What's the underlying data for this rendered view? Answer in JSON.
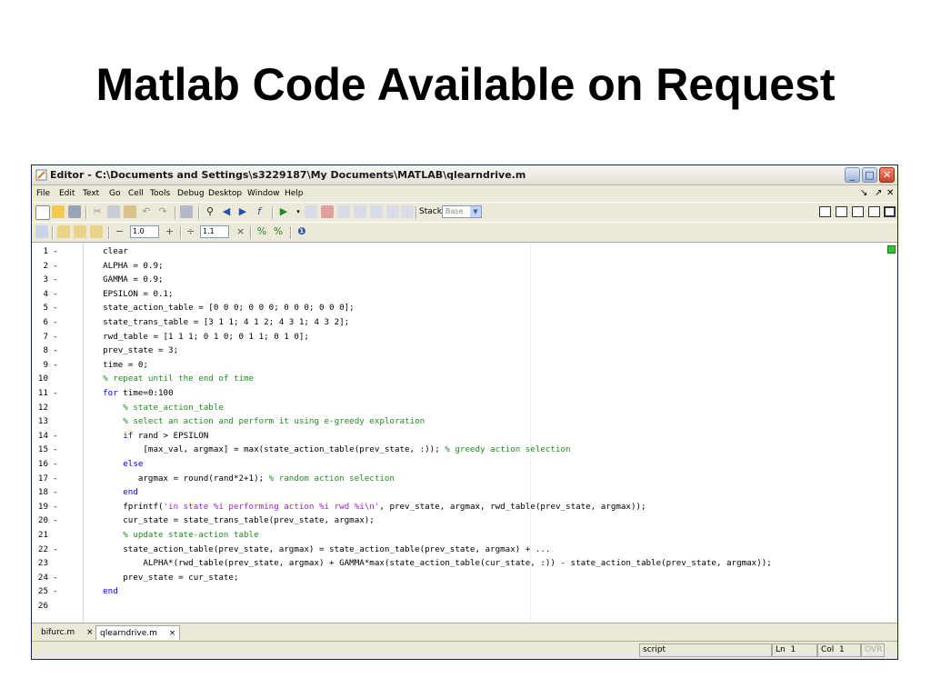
{
  "slide": {
    "title": "Matlab Code Available on Request"
  },
  "window": {
    "title": "Editor - C:\\Documents and Settings\\s3229187\\My Documents\\MATLAB\\qlearndrive.m",
    "min": "_",
    "max": "□",
    "close": "✕"
  },
  "menu": {
    "items": [
      "File",
      "Edit",
      "Text",
      "Go",
      "Cell",
      "Tools",
      "Debug",
      "Desktop",
      "Window",
      "Help"
    ],
    "dock_icons": [
      "↘",
      "↗",
      "✕"
    ]
  },
  "toolbar": {
    "stack_label": "Stack:",
    "stack_value": "Base"
  },
  "cellbar": {
    "minus": "−",
    "value1": "1.0",
    "plus": "+",
    "divide": "÷",
    "value2": "1.1",
    "times": "×"
  },
  "code": [
    {
      "n": "1",
      "d": "-",
      "segs": [
        {
          "t": "    clear",
          "c": ""
        }
      ]
    },
    {
      "n": "2",
      "d": "-",
      "segs": [
        {
          "t": "    ALPHA = 0.9;",
          "c": ""
        }
      ]
    },
    {
      "n": "3",
      "d": "-",
      "segs": [
        {
          "t": "    GAMMA = 0.9;",
          "c": ""
        }
      ]
    },
    {
      "n": "4",
      "d": "-",
      "segs": [
        {
          "t": "    EPSILON = 0.1;",
          "c": ""
        }
      ]
    },
    {
      "n": "5",
      "d": "-",
      "segs": [
        {
          "t": "    state_action_table = [0 0 0; 0 0 0; 0 0 0; 0 0 0];",
          "c": ""
        }
      ]
    },
    {
      "n": "6",
      "d": "-",
      "segs": [
        {
          "t": "    state_trans_table = [3 1 1; 4 1 2; 4 3 1; 4 3 2];",
          "c": ""
        }
      ]
    },
    {
      "n": "7",
      "d": "-",
      "segs": [
        {
          "t": "    rwd_table = [1 1 1; 0 1 0; 0 1 1; 0 1 0];",
          "c": ""
        }
      ]
    },
    {
      "n": "8",
      "d": "-",
      "segs": [
        {
          "t": "    prev_state = 3;",
          "c": ""
        }
      ]
    },
    {
      "n": "9",
      "d": "-",
      "segs": [
        {
          "t": "    time = 0;",
          "c": ""
        }
      ]
    },
    {
      "n": "10",
      "d": "",
      "segs": [
        {
          "t": "    % repeat until the end of time",
          "c": "cm"
        }
      ]
    },
    {
      "n": "11",
      "d": "-",
      "segs": [
        {
          "t": "    ",
          "c": ""
        },
        {
          "t": "for",
          "c": "kw"
        },
        {
          "t": " time=0:100",
          "c": ""
        }
      ]
    },
    {
      "n": "12",
      "d": "",
      "segs": [
        {
          "t": "        % state_action_table",
          "c": "cm"
        }
      ]
    },
    {
      "n": "13",
      "d": "",
      "segs": [
        {
          "t": "        % select an action and perform it using e-greedy exploration",
          "c": "cm"
        }
      ]
    },
    {
      "n": "14",
      "d": "-",
      "segs": [
        {
          "t": "        ",
          "c": ""
        },
        {
          "t": "if",
          "c": "kw"
        },
        {
          "t": " rand > EPSILON",
          "c": ""
        }
      ]
    },
    {
      "n": "15",
      "d": "-",
      "segs": [
        {
          "t": "            [max_val, argmax] = max(state_action_table(prev_state, :)); ",
          "c": ""
        },
        {
          "t": "% greedy action selection",
          "c": "cm"
        }
      ]
    },
    {
      "n": "16",
      "d": "-",
      "segs": [
        {
          "t": "        ",
          "c": ""
        },
        {
          "t": "else",
          "c": "kw"
        }
      ]
    },
    {
      "n": "17",
      "d": "-",
      "segs": [
        {
          "t": "           argmax = round(rand*2+1); ",
          "c": ""
        },
        {
          "t": "% random action selection",
          "c": "cm"
        }
      ]
    },
    {
      "n": "18",
      "d": "-",
      "segs": [
        {
          "t": "        ",
          "c": ""
        },
        {
          "t": "end",
          "c": "kw"
        }
      ]
    },
    {
      "n": "19",
      "d": "-",
      "segs": [
        {
          "t": "        fprintf(",
          "c": ""
        },
        {
          "t": "'in state %i performing action %i rwd %i\\n'",
          "c": "st"
        },
        {
          "t": ", prev_state, argmax, rwd_table(prev_state, argmax));",
          "c": ""
        }
      ]
    },
    {
      "n": "20",
      "d": "-",
      "segs": [
        {
          "t": "        cur_state = state_trans_table(prev_state, argmax);",
          "c": ""
        }
      ]
    },
    {
      "n": "21",
      "d": "",
      "segs": [
        {
          "t": "        % update state-action table",
          "c": "cm"
        }
      ]
    },
    {
      "n": "22",
      "d": "-",
      "segs": [
        {
          "t": "        state_action_table(prev_state, argmax) = state_action_table(prev_state, argmax) + ",
          "c": ""
        },
        {
          "t": "...",
          "c": "kw"
        }
      ]
    },
    {
      "n": "23",
      "d": "",
      "segs": [
        {
          "t": "            ALPHA*(rwd_table(prev_state, argmax) + GAMMA*max(state_action_table(cur_state, :)) - state_action_table(prev_state, argmax));",
          "c": ""
        }
      ]
    },
    {
      "n": "24",
      "d": "-",
      "segs": [
        {
          "t": "        prev_state = cur_state;",
          "c": ""
        }
      ]
    },
    {
      "n": "25",
      "d": "-",
      "segs": [
        {
          "t": "    ",
          "c": ""
        },
        {
          "t": "end",
          "c": "kw"
        }
      ]
    },
    {
      "n": "26",
      "d": "",
      "segs": [
        {
          "t": "",
          "c": ""
        }
      ]
    }
  ],
  "file_tabs": [
    {
      "name": "bifurc.m",
      "close": "×"
    },
    {
      "name": "qlearndrive.m",
      "close": "×"
    }
  ],
  "status": {
    "mode": "script",
    "ln_label": "Ln",
    "ln_value": "1",
    "col_label": "Col",
    "col_value": "1",
    "ovr": "OVR"
  },
  "colors": {
    "keyword": "#0000ff",
    "comment": "#228b22",
    "string": "#a020f0",
    "window_bg": "#ece9d8"
  }
}
